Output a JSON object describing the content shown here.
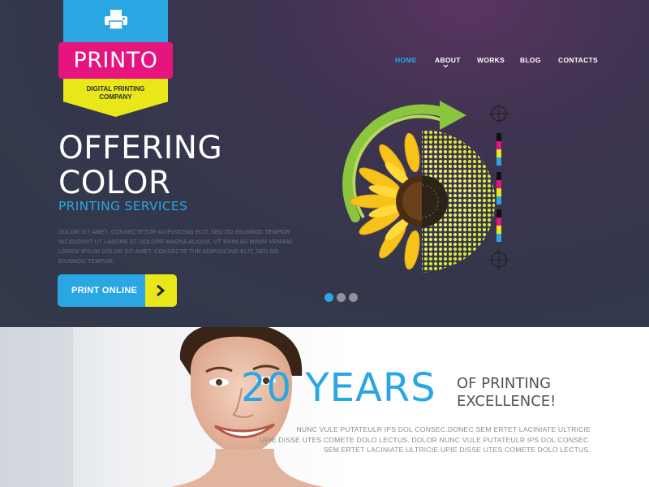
{
  "logo": {
    "brand": "PRINTO",
    "tagline": "DIGITAL PRINTING COMPANY",
    "icon": "printer-icon",
    "colors": {
      "cyan": "#2aa6e3",
      "magenta": "#e6147e",
      "yellow": "#e9e619"
    }
  },
  "nav": {
    "items": [
      {
        "label": "HOME",
        "active": true
      },
      {
        "label": "ABOUT",
        "active": false,
        "has_dropdown": true
      },
      {
        "label": "WORKS",
        "active": false
      },
      {
        "label": "BLOG",
        "active": false
      },
      {
        "label": "CONTACTS",
        "active": false
      }
    ]
  },
  "hero": {
    "headline_line1": "OFFERING",
    "headline_line2": "COLOR",
    "subheadline": "PRINTING SERVICES",
    "body": "DOLOR SIT AMET, CONSECTETUR ADIPISICING ELIT, SED DO EIUSMOD TEMPOR INCIDIDUNT UT LABORE ET DOLORE MAGNA ALIQUA. UT ENIM AD MINIM VENIAM. LOREM IPSUM DOLOR SIT AMET, CONSECTE TUR ADIPISICING ELIT, SED DO EIUSMOD TEMPOR.",
    "cta_label": "PRINT ONLINE",
    "cta_icon": "chevron-right-icon",
    "slider": {
      "count": 3,
      "active_index": 0
    },
    "artwork": "sunflower-halftone-illustration"
  },
  "feature": {
    "big_text": "20 YEARS",
    "caption_line1": "OF PRINTING",
    "caption_line2": "EXCELLENCE!",
    "body_line1": "NUNC VULE PUTATEULR IPS DOL CONSEC.DONEC SEM ERTET LACINIATE ULTRICIE",
    "body_line2": "UPIE DISSE UTES COMETE DOLO LECTUS. DOLOR NUNC VULE PUTATEULR IPS DOL CONSEC.",
    "body_line3": "SEM ERTET LACINIATE ULTRICIE UPIE DISSE UTES COMETE DOLO LECTUS.",
    "photo": "smiling-woman-photo"
  }
}
